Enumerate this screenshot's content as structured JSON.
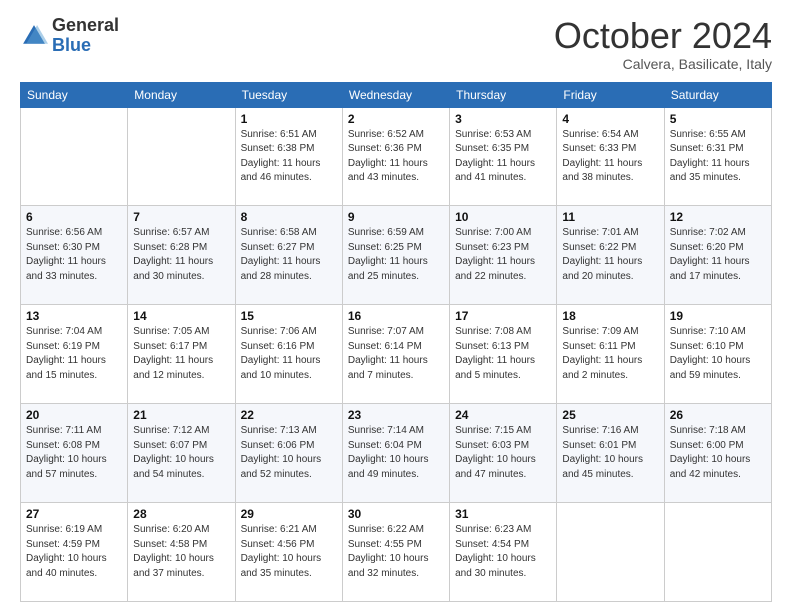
{
  "logo": {
    "general": "General",
    "blue": "Blue"
  },
  "calendar": {
    "title": "October 2024",
    "subtitle": "Calvera, Basilicate, Italy",
    "days": [
      "Sunday",
      "Monday",
      "Tuesday",
      "Wednesday",
      "Thursday",
      "Friday",
      "Saturday"
    ],
    "weeks": [
      [
        {
          "num": "",
          "sunrise": "",
          "sunset": "",
          "daylight": ""
        },
        {
          "num": "",
          "sunrise": "",
          "sunset": "",
          "daylight": ""
        },
        {
          "num": "1",
          "sunrise": "Sunrise: 6:51 AM",
          "sunset": "Sunset: 6:38 PM",
          "daylight": "Daylight: 11 hours and 46 minutes."
        },
        {
          "num": "2",
          "sunrise": "Sunrise: 6:52 AM",
          "sunset": "Sunset: 6:36 PM",
          "daylight": "Daylight: 11 hours and 43 minutes."
        },
        {
          "num": "3",
          "sunrise": "Sunrise: 6:53 AM",
          "sunset": "Sunset: 6:35 PM",
          "daylight": "Daylight: 11 hours and 41 minutes."
        },
        {
          "num": "4",
          "sunrise": "Sunrise: 6:54 AM",
          "sunset": "Sunset: 6:33 PM",
          "daylight": "Daylight: 11 hours and 38 minutes."
        },
        {
          "num": "5",
          "sunrise": "Sunrise: 6:55 AM",
          "sunset": "Sunset: 6:31 PM",
          "daylight": "Daylight: 11 hours and 35 minutes."
        }
      ],
      [
        {
          "num": "6",
          "sunrise": "Sunrise: 6:56 AM",
          "sunset": "Sunset: 6:30 PM",
          "daylight": "Daylight: 11 hours and 33 minutes."
        },
        {
          "num": "7",
          "sunrise": "Sunrise: 6:57 AM",
          "sunset": "Sunset: 6:28 PM",
          "daylight": "Daylight: 11 hours and 30 minutes."
        },
        {
          "num": "8",
          "sunrise": "Sunrise: 6:58 AM",
          "sunset": "Sunset: 6:27 PM",
          "daylight": "Daylight: 11 hours and 28 minutes."
        },
        {
          "num": "9",
          "sunrise": "Sunrise: 6:59 AM",
          "sunset": "Sunset: 6:25 PM",
          "daylight": "Daylight: 11 hours and 25 minutes."
        },
        {
          "num": "10",
          "sunrise": "Sunrise: 7:00 AM",
          "sunset": "Sunset: 6:23 PM",
          "daylight": "Daylight: 11 hours and 22 minutes."
        },
        {
          "num": "11",
          "sunrise": "Sunrise: 7:01 AM",
          "sunset": "Sunset: 6:22 PM",
          "daylight": "Daylight: 11 hours and 20 minutes."
        },
        {
          "num": "12",
          "sunrise": "Sunrise: 7:02 AM",
          "sunset": "Sunset: 6:20 PM",
          "daylight": "Daylight: 11 hours and 17 minutes."
        }
      ],
      [
        {
          "num": "13",
          "sunrise": "Sunrise: 7:04 AM",
          "sunset": "Sunset: 6:19 PM",
          "daylight": "Daylight: 11 hours and 15 minutes."
        },
        {
          "num": "14",
          "sunrise": "Sunrise: 7:05 AM",
          "sunset": "Sunset: 6:17 PM",
          "daylight": "Daylight: 11 hours and 12 minutes."
        },
        {
          "num": "15",
          "sunrise": "Sunrise: 7:06 AM",
          "sunset": "Sunset: 6:16 PM",
          "daylight": "Daylight: 11 hours and 10 minutes."
        },
        {
          "num": "16",
          "sunrise": "Sunrise: 7:07 AM",
          "sunset": "Sunset: 6:14 PM",
          "daylight": "Daylight: 11 hours and 7 minutes."
        },
        {
          "num": "17",
          "sunrise": "Sunrise: 7:08 AM",
          "sunset": "Sunset: 6:13 PM",
          "daylight": "Daylight: 11 hours and 5 minutes."
        },
        {
          "num": "18",
          "sunrise": "Sunrise: 7:09 AM",
          "sunset": "Sunset: 6:11 PM",
          "daylight": "Daylight: 11 hours and 2 minutes."
        },
        {
          "num": "19",
          "sunrise": "Sunrise: 7:10 AM",
          "sunset": "Sunset: 6:10 PM",
          "daylight": "Daylight: 10 hours and 59 minutes."
        }
      ],
      [
        {
          "num": "20",
          "sunrise": "Sunrise: 7:11 AM",
          "sunset": "Sunset: 6:08 PM",
          "daylight": "Daylight: 10 hours and 57 minutes."
        },
        {
          "num": "21",
          "sunrise": "Sunrise: 7:12 AM",
          "sunset": "Sunset: 6:07 PM",
          "daylight": "Daylight: 10 hours and 54 minutes."
        },
        {
          "num": "22",
          "sunrise": "Sunrise: 7:13 AM",
          "sunset": "Sunset: 6:06 PM",
          "daylight": "Daylight: 10 hours and 52 minutes."
        },
        {
          "num": "23",
          "sunrise": "Sunrise: 7:14 AM",
          "sunset": "Sunset: 6:04 PM",
          "daylight": "Daylight: 10 hours and 49 minutes."
        },
        {
          "num": "24",
          "sunrise": "Sunrise: 7:15 AM",
          "sunset": "Sunset: 6:03 PM",
          "daylight": "Daylight: 10 hours and 47 minutes."
        },
        {
          "num": "25",
          "sunrise": "Sunrise: 7:16 AM",
          "sunset": "Sunset: 6:01 PM",
          "daylight": "Daylight: 10 hours and 45 minutes."
        },
        {
          "num": "26",
          "sunrise": "Sunrise: 7:18 AM",
          "sunset": "Sunset: 6:00 PM",
          "daylight": "Daylight: 10 hours and 42 minutes."
        }
      ],
      [
        {
          "num": "27",
          "sunrise": "Sunrise: 6:19 AM",
          "sunset": "Sunset: 4:59 PM",
          "daylight": "Daylight: 10 hours and 40 minutes."
        },
        {
          "num": "28",
          "sunrise": "Sunrise: 6:20 AM",
          "sunset": "Sunset: 4:58 PM",
          "daylight": "Daylight: 10 hours and 37 minutes."
        },
        {
          "num": "29",
          "sunrise": "Sunrise: 6:21 AM",
          "sunset": "Sunset: 4:56 PM",
          "daylight": "Daylight: 10 hours and 35 minutes."
        },
        {
          "num": "30",
          "sunrise": "Sunrise: 6:22 AM",
          "sunset": "Sunset: 4:55 PM",
          "daylight": "Daylight: 10 hours and 32 minutes."
        },
        {
          "num": "31",
          "sunrise": "Sunrise: 6:23 AM",
          "sunset": "Sunset: 4:54 PM",
          "daylight": "Daylight: 10 hours and 30 minutes."
        },
        {
          "num": "",
          "sunrise": "",
          "sunset": "",
          "daylight": ""
        },
        {
          "num": "",
          "sunrise": "",
          "sunset": "",
          "daylight": ""
        }
      ]
    ]
  }
}
